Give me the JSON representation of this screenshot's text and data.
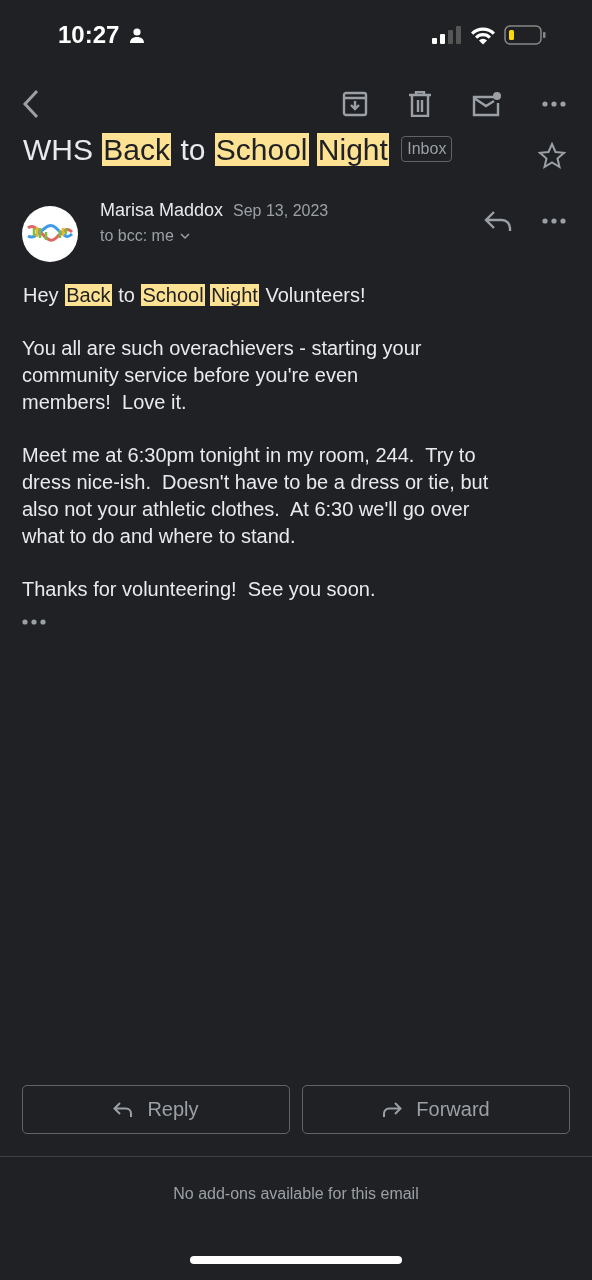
{
  "status_bar": {
    "time": "10:27"
  },
  "subject": {
    "words": [
      {
        "text": "WHS",
        "highlighted": false
      },
      {
        "text": "Back",
        "highlighted": true
      },
      {
        "text": "to",
        "highlighted": false
      },
      {
        "text": "School",
        "highlighted": true
      },
      {
        "text": "Night",
        "highlighted": true
      }
    ],
    "label": "Inbox",
    "starred": false
  },
  "message": {
    "sender": "Marisa Maddox",
    "date": "Sep 13, 2023",
    "recipients": "to bcc: me",
    "greeting": [
      {
        "text": "Hey",
        "highlighted": false
      },
      {
        "text": "Back",
        "highlighted": true
      },
      {
        "text": "to",
        "highlighted": false
      },
      {
        "text": "School",
        "highlighted": true
      },
      {
        "text": "Night",
        "highlighted": true
      },
      {
        "text": "Volunteers!",
        "highlighted": false
      }
    ],
    "paragraphs": [
      [
        "You all are such overachievers - starting your",
        "community service before you're even",
        "members!  Love it."
      ],
      [
        "Meet me at 6:30pm tonight in my room, 244.  Try to",
        "dress nice-ish.  Doesn't have to be a dress or tie, but",
        "also not your athletic clothes.  At 6:30 we'll go over",
        "what to do and where to stand."
      ],
      [
        "Thanks for volunteering!  See you soon."
      ]
    ]
  },
  "actions": [
    {
      "kind": "reply",
      "label": "Reply"
    },
    {
      "kind": "forward",
      "label": "Forward"
    }
  ],
  "footer": "No add-ons available for this email"
}
